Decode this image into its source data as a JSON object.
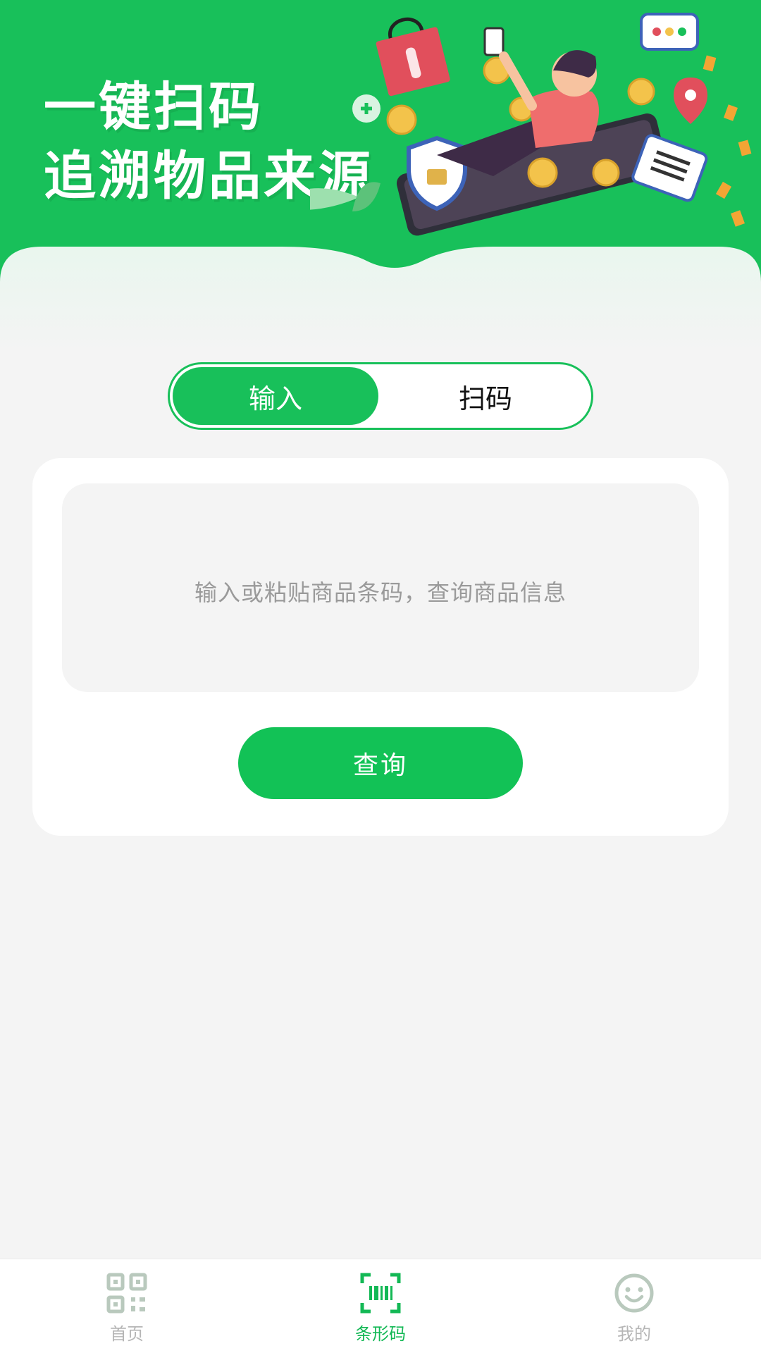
{
  "banner": {
    "title_line1": "一键扫码",
    "title_line2": "追溯物品来源"
  },
  "mode_toggle": {
    "options": [
      {
        "label": "输入",
        "active": true
      },
      {
        "label": "扫码",
        "active": false
      }
    ]
  },
  "query_card": {
    "input_value": "",
    "input_placeholder": "输入或粘贴商品条码，查询商品信息",
    "submit_label": "查询"
  },
  "bottom_nav": {
    "items": [
      {
        "label": "首页",
        "icon": "qr-code-icon",
        "active": false
      },
      {
        "label": "条形码",
        "icon": "barcode-scan-icon",
        "active": true
      },
      {
        "label": "我的",
        "icon": "smiley-face-icon",
        "active": false
      }
    ]
  },
  "colors": {
    "brand_green": "#18c05a",
    "page_background": "#f4f4f4",
    "inactive_nav": "#b6b6b6"
  }
}
